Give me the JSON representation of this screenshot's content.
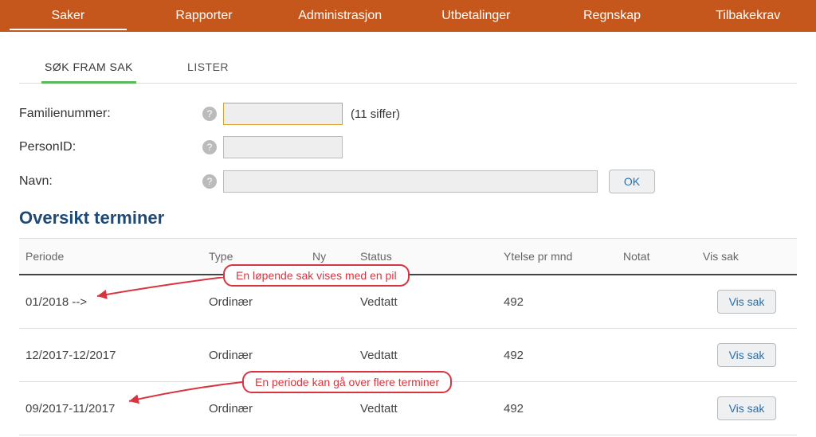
{
  "nav": {
    "items": [
      {
        "label": "Saker",
        "active": true
      },
      {
        "label": "Rapporter"
      },
      {
        "label": "Administrasjon"
      },
      {
        "label": "Utbetalinger"
      },
      {
        "label": "Regnskap"
      },
      {
        "label": "Tilbakekrav"
      }
    ]
  },
  "subtabs": {
    "items": [
      {
        "label": "SØK FRAM SAK",
        "active": true
      },
      {
        "label": "LISTER"
      }
    ]
  },
  "form": {
    "familienummer_label": "Familienummer:",
    "familienummer_hint": "(11 siffer)",
    "personid_label": "PersonID:",
    "navn_label": "Navn:",
    "ok_label": "OK",
    "help_glyph": "?"
  },
  "section": {
    "title": "Oversikt terminer"
  },
  "table": {
    "headers": {
      "periode": "Periode",
      "type": "Type",
      "ny": "Ny",
      "status": "Status",
      "ytelse": "Ytelse pr mnd",
      "notat": "Notat",
      "vissak": "Vis sak"
    },
    "rows": [
      {
        "periode": "01/2018 -->",
        "type": "Ordinær",
        "ny": "",
        "status": "Vedtatt",
        "ytelse": "492",
        "notat": "",
        "vissak": "Vis sak"
      },
      {
        "periode": "12/2017-12/2017",
        "type": "Ordinær",
        "ny": "",
        "status": "Vedtatt",
        "ytelse": "492",
        "notat": "",
        "vissak": "Vis sak"
      },
      {
        "periode": "09/2017-11/2017",
        "type": "Ordinær",
        "ny": "",
        "status": "Vedtatt",
        "ytelse": "492",
        "notat": "",
        "vissak": "Vis sak"
      }
    ]
  },
  "callouts": {
    "top": "En løpende sak vises med en pil",
    "mid": "En periode kan gå over flere terminer"
  }
}
